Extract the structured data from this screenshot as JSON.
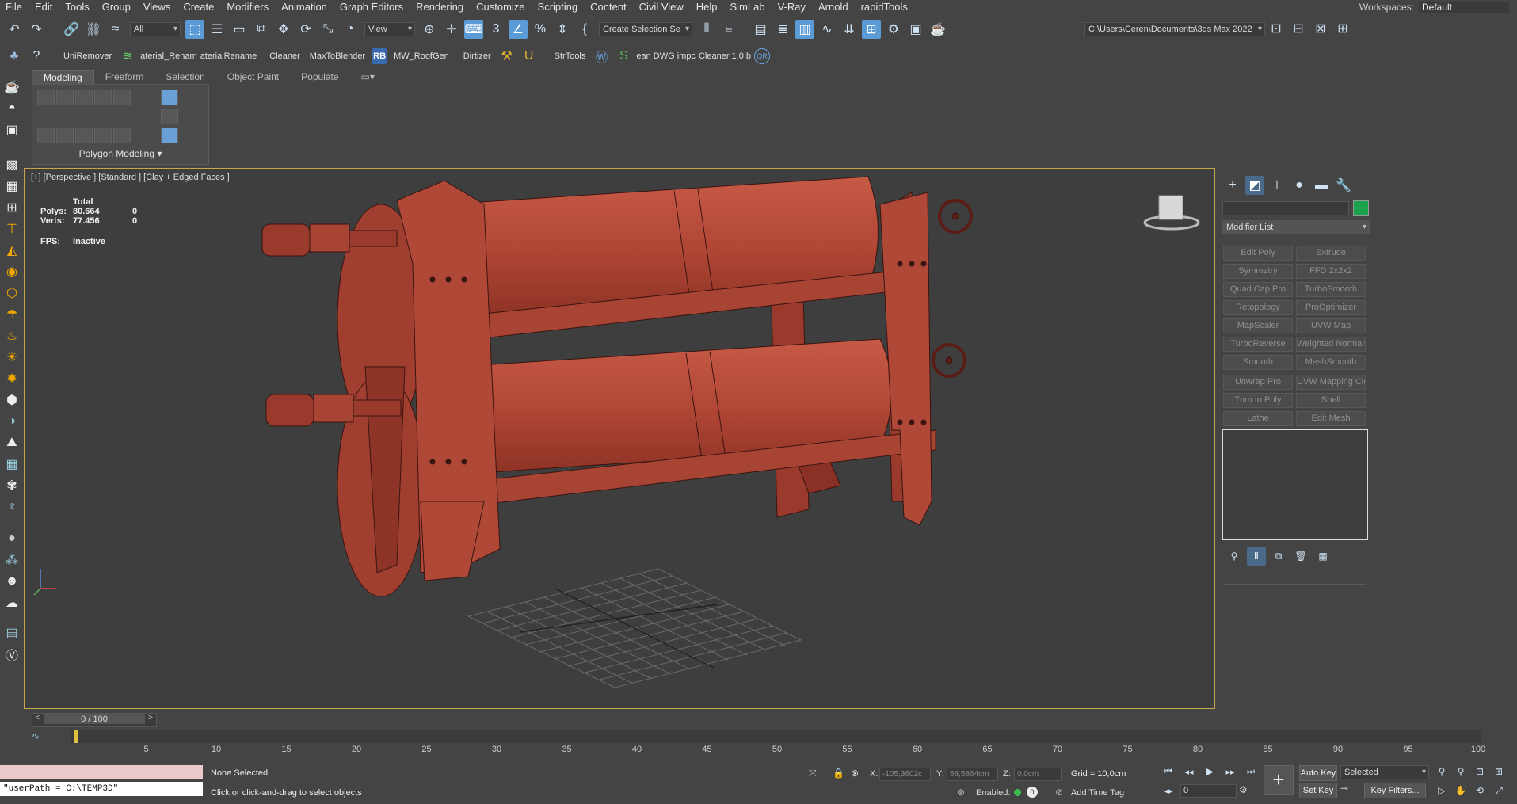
{
  "menu": [
    "File",
    "Edit",
    "Tools",
    "Group",
    "Views",
    "Create",
    "Modifiers",
    "Animation",
    "Graph Editors",
    "Rendering",
    "Customize",
    "Scripting",
    "Content",
    "Civil View",
    "Help",
    "SimLab",
    "V-Ray",
    "Arnold",
    "rapidTools"
  ],
  "workspaces": {
    "label": "Workspaces:",
    "value": "Default"
  },
  "toolbar": {
    "selection_filter": "All",
    "ref_coord": "View",
    "named_selection": "Create Selection Se",
    "project_path": "C:\\Users\\Ceren\\Documents\\3ds Max 2022"
  },
  "scripts_bar": [
    "UniRemover",
    "aterial_Renam",
    "aterialRename",
    "Cleaner",
    "MaxToBlender",
    "RB",
    "MW_RoofGen",
    "Dirtizer",
    "StrTools",
    "ean DWG impc",
    "Cleaner 1.0 b",
    "QR"
  ],
  "ribbon": {
    "tabs": [
      "Modeling",
      "Freeform",
      "Selection",
      "Object Paint",
      "Populate"
    ],
    "panel_label": "Polygon Modeling"
  },
  "viewport": {
    "label": "[+] [Perspective ] [Standard ] [Clay + Edged Faces ]",
    "stats": {
      "header": "Total",
      "polys_label": "Polys:",
      "polys_value": "80.664",
      "polys_sel": "0",
      "verts_label": "Verts:",
      "verts_value": "77.456",
      "verts_sel": "0",
      "fps_label": "FPS:",
      "fps_value": "Inactive"
    },
    "model_color": "#b84a3a"
  },
  "command_panel": {
    "modifier_list": "Modifier List",
    "color_swatch": "#1aa34a",
    "buttons": [
      [
        "Edit Poly",
        "Extrude"
      ],
      [
        "Symmetry",
        "FFD 2x2x2"
      ],
      [
        "Quad Cap Pro",
        "TurboSmooth"
      ],
      [
        "Retopology",
        "ProOptimizer"
      ],
      [
        "MapScaler",
        "UVW Map"
      ],
      [
        "TurboReverse",
        "Weighted Normals"
      ],
      [
        "Smooth",
        "MeshSmooth"
      ],
      [
        "Unwrap Pro",
        "UVW Mapping Clea"
      ],
      [
        "Turn to Poly",
        "Shell"
      ],
      [
        "Lathe",
        "Edit Mesh"
      ]
    ]
  },
  "timeline": {
    "slider": "0 / 100",
    "ticks": [
      "5",
      "10",
      "15",
      "20",
      "25",
      "30",
      "35",
      "40",
      "45",
      "50",
      "55",
      "60",
      "65",
      "70",
      "75",
      "80",
      "85",
      "90",
      "95",
      "100"
    ]
  },
  "status": {
    "script_line": "\"userPath = C:\\TEMP3D\"",
    "selection": "None Selected",
    "prompt": "Click or click-and-drag to select objects",
    "x_label": "X:",
    "x_value": "-105,3602c",
    "y_label": "Y:",
    "y_value": "58,5864cm",
    "z_label": "Z:",
    "z_value": "0,0cm",
    "grid": "Grid = 10,0cm",
    "enabled": "Enabled:",
    "enabled_count": "0",
    "add_time_tag": "Add Time Tag",
    "auto_key": "Auto Key",
    "set_key": "Set Key",
    "key_mode": "Selected",
    "frame": "0",
    "key_filters": "Key Filters..."
  }
}
